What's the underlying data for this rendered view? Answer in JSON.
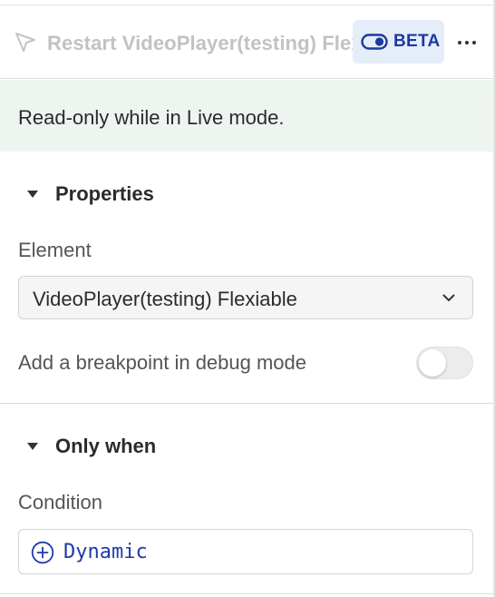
{
  "header": {
    "title": "Restart VideoPlayer(testing) Flexiable",
    "title_icon": "cursor-arrow-icon",
    "beta_badge": {
      "label": "BETA",
      "icon": "toggle-icon",
      "color": "#1b3a9e",
      "background": "#e6edfa"
    },
    "more_icon": "more-horizontal-icon"
  },
  "notice": {
    "text": "Read-only while in Live mode.",
    "background": "#eef5f0"
  },
  "properties": {
    "section_title": "Properties",
    "element_label": "Element",
    "element_value": "VideoPlayer(testing) Flexiable",
    "breakpoint_label": "Add a breakpoint in debug mode",
    "breakpoint_enabled": false
  },
  "only_when": {
    "section_title": "Only when",
    "condition_label": "Condition",
    "condition_value": "Dynamic",
    "condition_color": "#1f3aa8"
  }
}
